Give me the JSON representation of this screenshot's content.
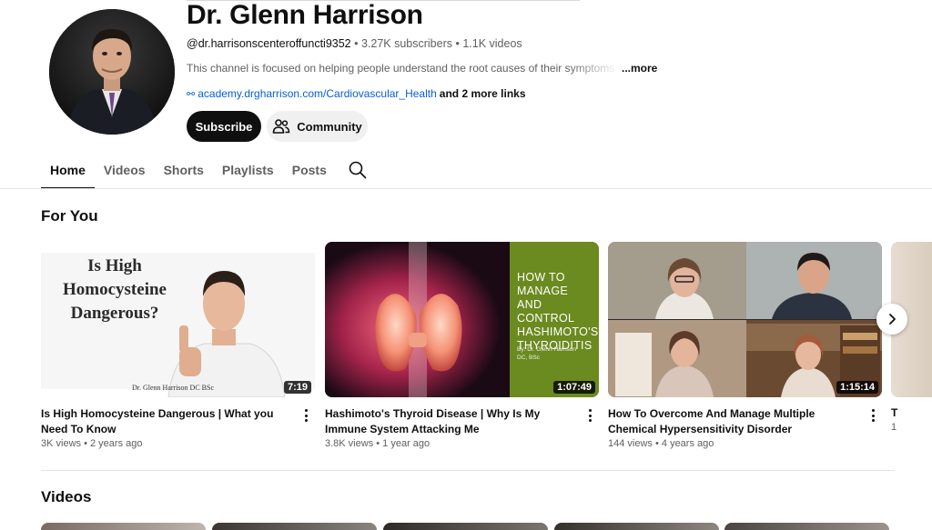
{
  "channel": {
    "name": "Dr. Glenn Harrison",
    "handle": "@dr.harrisonscenteroffuncti9352",
    "subscribers": "3.27K subscribers",
    "videos": "1.1K videos",
    "separator": " • ",
    "description": "This channel is focused on helping people understand the root causes of their symptoms",
    "more_label": "...more",
    "link_url": "academy.drgharrison.com/Cardiovascular_Health",
    "more_links": "and 2 more links",
    "subscribe_label": "Subscribe",
    "community_label": "Community"
  },
  "tabs": [
    {
      "label": "Home",
      "active": true
    },
    {
      "label": "Videos",
      "active": false
    },
    {
      "label": "Shorts",
      "active": false
    },
    {
      "label": "Playlists",
      "active": false
    },
    {
      "label": "Posts",
      "active": false
    }
  ],
  "for_you": {
    "title": "For You",
    "videos": [
      {
        "title": "Is High Homocysteine Dangerous | What you Need To Know",
        "views": "3K views",
        "age": "2 years ago",
        "duration": "7:19",
        "thumb_text": "Is High Homocysteine Dangerous?",
        "thumb_caption": "Dr. Glenn Harrison DC BSc"
      },
      {
        "title": "Hashimoto's Thyroid Disease  | Why Is My Immune System Attacking Me",
        "views": "3.8K views",
        "age": "1 year ago",
        "duration": "1:07:49",
        "thumb_text": "HOW TO MANAGE AND CONTROL HASHIMOTO'S THYROIDITIS",
        "thumb_caption": "By: Dr. Glenn Harrison DC, BSc"
      },
      {
        "title": "How To Overcome And Manage Multiple Chemical Hypersensitivity Disorder",
        "views": "144 views",
        "age": "4 years ago",
        "duration": "1:15:14"
      }
    ],
    "peek_title": "T",
    "peek_title2": "1",
    "peek_meta": "1"
  },
  "videos_section": {
    "title": "Videos"
  },
  "colors": {
    "accent_link": "#065fd4",
    "subscribe_bg": "#0f0f0f",
    "thyroid_panel": "#6b8a1f"
  },
  "icons": {
    "search": "search-icon",
    "community": "people-icon",
    "next": "chevron-right-icon",
    "link": "link-icon",
    "menu": "vertical-dots-icon"
  }
}
